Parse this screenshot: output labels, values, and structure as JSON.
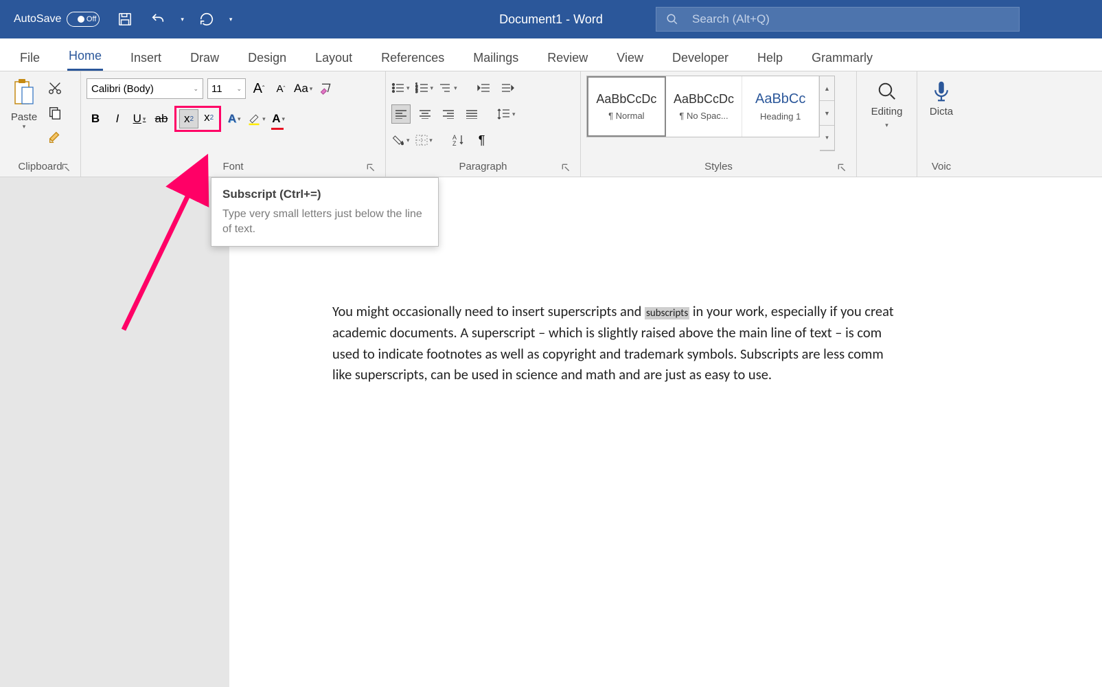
{
  "titlebar": {
    "autosave_label": "AutoSave",
    "autosave_state": "Off",
    "document_title": "Document1  -  Word",
    "search_placeholder": "Search (Alt+Q)"
  },
  "tabs": [
    "File",
    "Home",
    "Insert",
    "Draw",
    "Design",
    "Layout",
    "References",
    "Mailings",
    "Review",
    "View",
    "Developer",
    "Help",
    "Grammarly"
  ],
  "active_tab": "Home",
  "ribbon": {
    "clipboard": {
      "label": "Clipboard",
      "paste": "Paste"
    },
    "font": {
      "label": "Font",
      "family": "Calibri (Body)",
      "size": "11"
    },
    "paragraph": {
      "label": "Paragraph"
    },
    "styles": {
      "label": "Styles",
      "items": [
        {
          "preview": "AaBbCcDc",
          "name": "¶ Normal"
        },
        {
          "preview": "AaBbCcDc",
          "name": "¶ No Spac..."
        },
        {
          "preview": "AaBbCc",
          "name": "Heading 1"
        }
      ]
    },
    "editing": {
      "label": "Editing"
    },
    "voice": {
      "label": "Voic",
      "dictate": "Dicta"
    }
  },
  "tooltip": {
    "title": "Subscript (Ctrl+=)",
    "desc": "Type very small letters just below the line of text."
  },
  "document": {
    "line1_a": "You might occasionally need to insert superscripts and ",
    "line1_sel": "subscripts",
    "line1_b": " in your work, especially if you creat",
    "line2": "academic documents. A superscript – which is slightly raised above the main line of text – is com",
    "line3": "used to indicate footnotes as well as copyright and trademark symbols. Subscripts are less comm",
    "line4": "like superscripts, can be used in science and math and are just as easy to use."
  }
}
